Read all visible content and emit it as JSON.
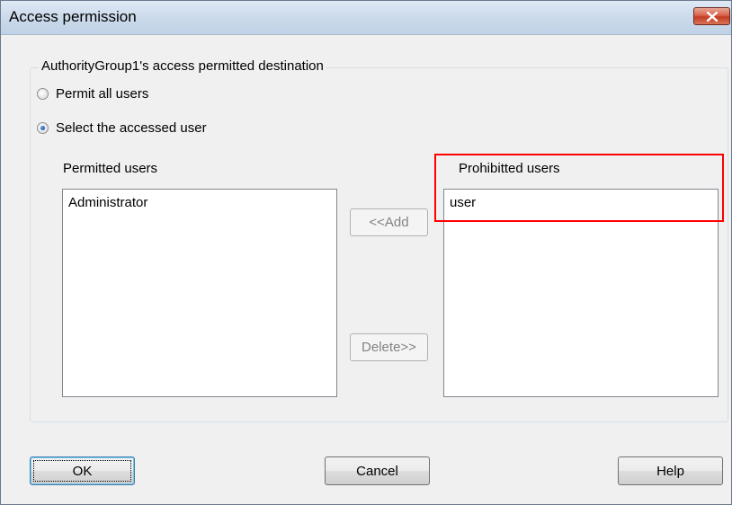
{
  "window": {
    "title": "Access permission"
  },
  "group": {
    "legend": "AuthorityGroup1's access permitted destination"
  },
  "radios": {
    "permit_all": {
      "label": "Permit all users",
      "checked": false
    },
    "select_user": {
      "label": "Select the accessed user",
      "checked": true
    }
  },
  "permitted": {
    "header": "Permitted users",
    "items": [
      "Administrator"
    ]
  },
  "prohibited": {
    "header": "Prohibitted users",
    "items": [
      "user"
    ]
  },
  "buttons": {
    "add": "<<Add",
    "delete": "Delete>>",
    "ok": "OK",
    "cancel": "Cancel",
    "help": "Help"
  },
  "colors": {
    "highlight": "#ff0000",
    "close_button": "#c33d23"
  },
  "icons": {
    "close": "close-icon"
  }
}
